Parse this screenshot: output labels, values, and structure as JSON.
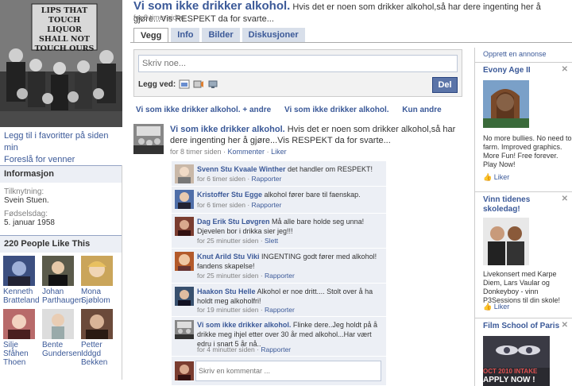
{
  "left": {
    "profile_sign": [
      "LIPS THAT",
      "TOUCH LIQUOR",
      "SHALL NOT",
      "TOUCH OURS"
    ],
    "links": [
      "Legg til i favoritter på siden min",
      "Foreslå for venner"
    ],
    "info_header": "Informasjon",
    "info": [
      {
        "label": "Tilknytning:",
        "value": "Svein Stuen."
      },
      {
        "label": "Fødselsdag:",
        "value": "5. januar 1958"
      }
    ],
    "people_header": "220 People Like This",
    "people": [
      {
        "name": "Kenneth Bratteland"
      },
      {
        "name": "Johan Parthaugen"
      },
      {
        "name": "Mona Sjøblom"
      },
      {
        "name": "Silje Sfåhen Thoen"
      },
      {
        "name": "Bente Gundersen"
      },
      {
        "name": "Petter Iddgd Bekken"
      }
    ]
  },
  "header": {
    "title": "Vi som ikke drikker alkohol.",
    "status": "Hvis det er noen som drikker alkohol,så har dere ingenting her å gjøre...Vis RESPEKT da for svarte...",
    "timestamp": "for 8 timer siden"
  },
  "tabs": [
    {
      "label": "Vegg",
      "active": true
    },
    {
      "label": "Info",
      "active": false
    },
    {
      "label": "Bilder",
      "active": false
    },
    {
      "label": "Diskusjoner",
      "active": false
    }
  ],
  "composer": {
    "placeholder": "Skriv noe...",
    "attach_label": "Legg ved:",
    "submit_label": "Del"
  },
  "filters": [
    "Vi som ikke drikker alkohol. + andre",
    "Vi som ikke drikker alkohol.",
    "Kun andre"
  ],
  "post": {
    "author": "Vi som ikke drikker alkohol.",
    "text": "Hvis det er noen som drikker alkohol,så har dere ingenting her å gjøre...Vis RESPEKT da for svarte...",
    "time": "for 8 timer siden",
    "comment_label": "Kommenter",
    "like_label": "Liker"
  },
  "comments": [
    {
      "author": "Svenn Stu Kvaale Winther",
      "text": "det handler om RESPEKT!",
      "time": "for 6 timer siden",
      "action": "Rapporter"
    },
    {
      "author": "Kristoffer Stu Egge",
      "text": "alkohol fører bare til faenskap.",
      "time": "for 6 timer siden",
      "action": "Rapporter"
    },
    {
      "author": "Dag Erik Stu Løvgren",
      "text": "Må alle bare holde seg unna! Djevelen bor i drikka sier jeg!!!",
      "time": "for 25 minutter siden",
      "action": "Slett"
    },
    {
      "author": "Knut Arild Stu Viki",
      "text": "INGENTING godt fører med alkohol! fandens skapelse!",
      "time": "for 25 minutter siden",
      "action": "Rapporter"
    },
    {
      "author": "Haakon Stu Helle",
      "text": "Alkohol er noe dritt.... Stolt over å ha holdt meg alkoholfri!",
      "time": "for 19 minutter siden",
      "action": "Rapporter"
    },
    {
      "author": "Vi som ikke drikker alkohol.",
      "text": "Flinke dere..Jeg holdt på å drikke meg ihjel etter over 30 år med alkohol...Har vært edru i snart 5 år nå..",
      "time": "for 4 minutter siden",
      "action": "Rapporter"
    }
  ],
  "comment_box": {
    "placeholder": "Skriv en kommentar ..."
  },
  "ads": {
    "create_label": "Opprett en annonse",
    "items": [
      {
        "title": "Evony Age II",
        "text": "No more bullies. No need to farm. Improved graphics. More Fun! Free forever. Play Now!",
        "like": "Liker"
      },
      {
        "title": "Vinn tidenes skoledag!",
        "text": "Livekonsert med Karpe Diem, Lars Vaular og Donkeyboy - vinn P3Sessions til din skole!",
        "like": "Liker"
      },
      {
        "title": "Film School of Paris",
        "image_text": [
          "OCT 2010 INTAKE",
          "APPLY NOW !"
        ]
      }
    ]
  }
}
